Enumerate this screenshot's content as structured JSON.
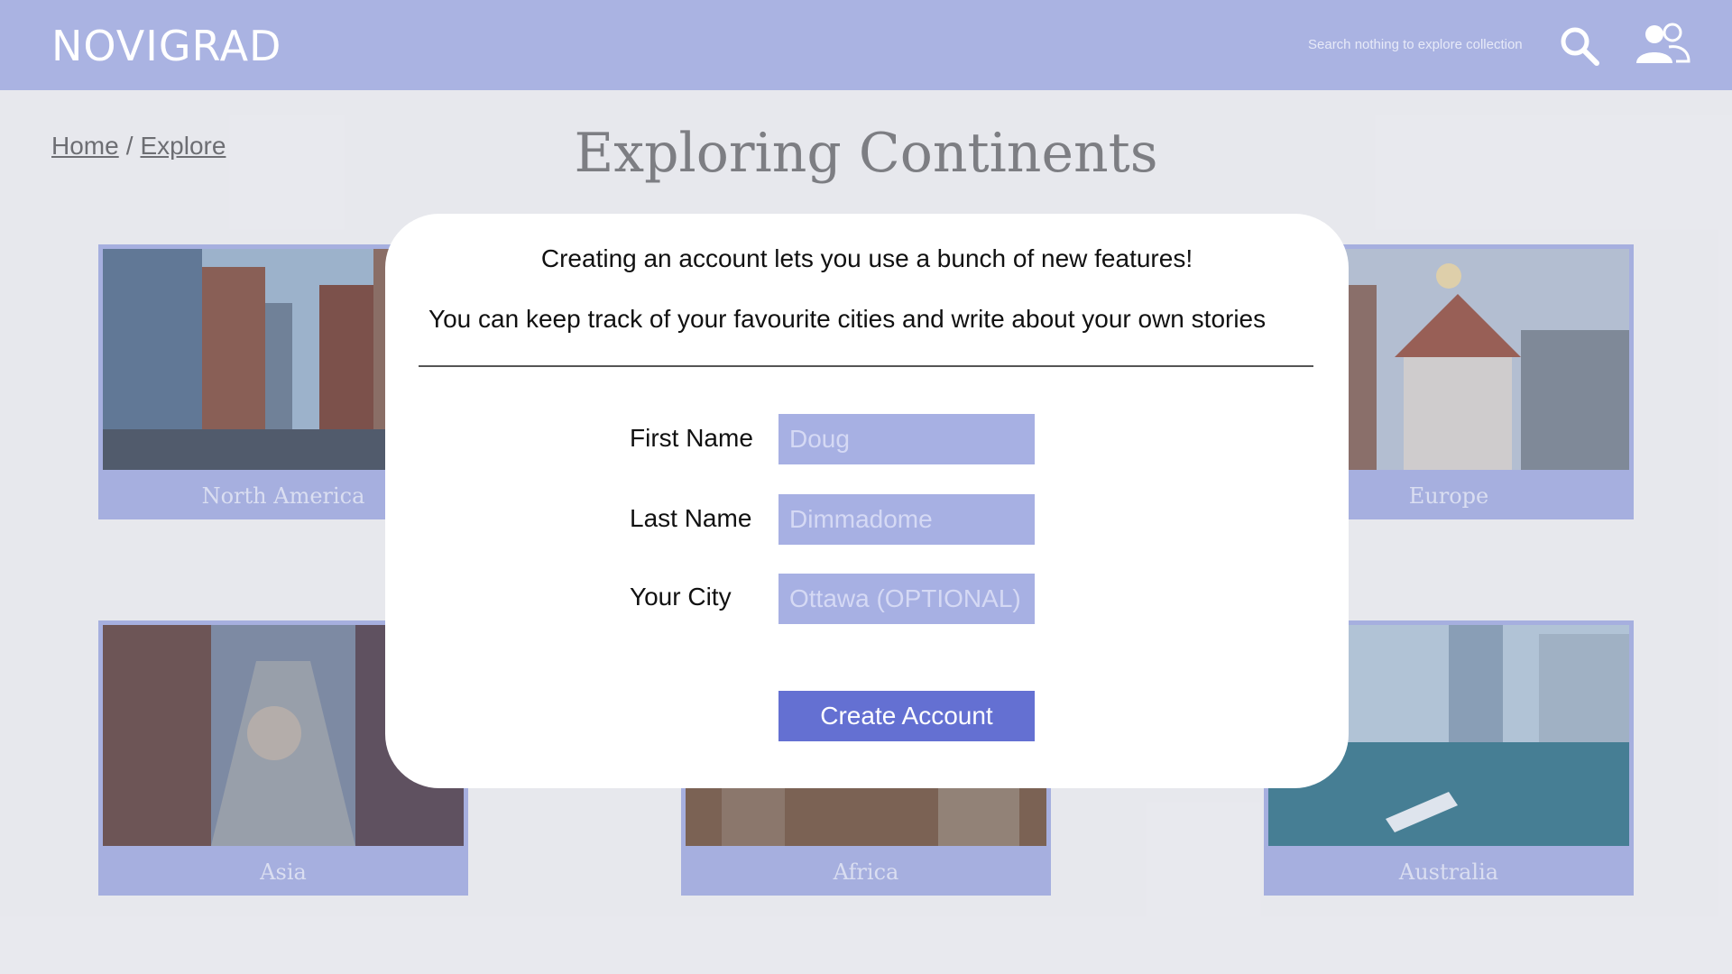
{
  "header": {
    "brand": "NOVIGRAD",
    "search_hint": "Search nothing to explore collection",
    "search_icon": "search-icon",
    "user_icon": "users-icon"
  },
  "breadcrumb": {
    "home": "Home",
    "separator": "/",
    "current": "Explore"
  },
  "page": {
    "title": "Exploring Continents"
  },
  "cards": [
    {
      "label": "North America"
    },
    {
      "label": "Europe"
    },
    {
      "label": "Asia"
    },
    {
      "label": "Africa"
    },
    {
      "label": "Australia"
    }
  ],
  "modal": {
    "line1": "Creating an account lets you use a bunch of new features!",
    "line2": "You can keep track of your favourite cities and write about your own stories",
    "fields": [
      {
        "label": "First Name",
        "placeholder": "Doug"
      },
      {
        "label": "Last Name",
        "placeholder": "Dimmadome"
      },
      {
        "label": "Your City",
        "placeholder": "Ottawa (OPTIONAL)"
      }
    ],
    "submit_label": "Create Account"
  },
  "colors": {
    "accent": "#aab3e2",
    "button": "#6470d2",
    "background": "#f2f2f2"
  }
}
